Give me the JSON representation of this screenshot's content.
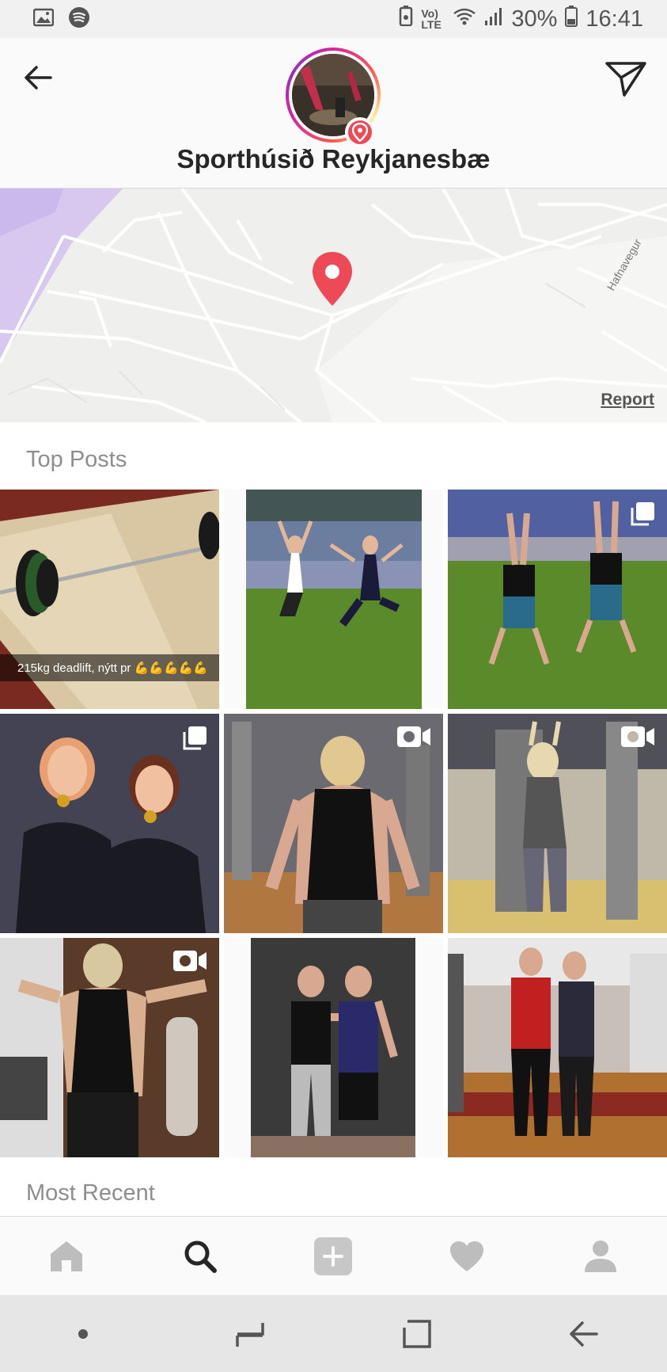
{
  "status_bar": {
    "battery": "30%",
    "time": "16:41",
    "network": "Vo) LTE",
    "left_icons": [
      "gallery-icon",
      "spotify-icon"
    ]
  },
  "header": {
    "place_name": "Sporthúsið Reykjanesbæ",
    "back_icon": "arrow-left-icon",
    "share_icon": "paper-plane-icon"
  },
  "map": {
    "street_label": "Hafnavegur",
    "report_label": "Report"
  },
  "sections": {
    "top_posts": "Top Posts",
    "most_recent": "Most Recent"
  },
  "posts": [
    {
      "caption": "215kg deadlift, nýtt pr 💪💪💪💪💪",
      "badge": ""
    },
    {
      "caption": "",
      "badge": ""
    },
    {
      "caption": "",
      "badge": "multiple-photos-icon"
    },
    {
      "caption": "",
      "badge": "multiple-photos-icon"
    },
    {
      "caption": "",
      "badge": "video-camera-icon"
    },
    {
      "caption": "",
      "badge": "video-camera-icon"
    },
    {
      "caption": "",
      "badge": "video-camera-icon"
    },
    {
      "caption": "",
      "badge": ""
    },
    {
      "caption": "",
      "badge": ""
    }
  ],
  "bottom_nav": [
    "home-icon",
    "search-icon",
    "new-post-icon",
    "heart-icon",
    "profile-icon"
  ],
  "colors": {
    "pin": "#ed4956",
    "text_dark": "#262626",
    "text_muted": "#8e8e8e"
  }
}
